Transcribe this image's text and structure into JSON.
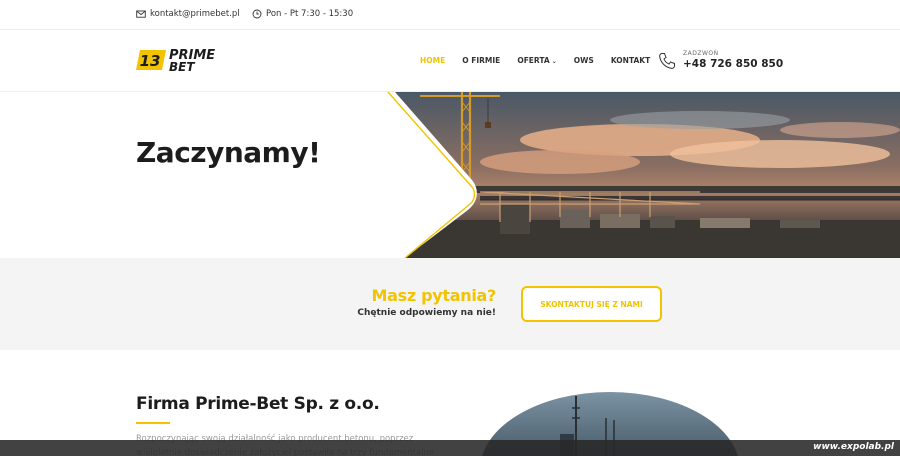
{
  "topbar": {
    "email": "kontakt@primebet.pl",
    "hours": "Pon - Pt 7:30 - 15:30"
  },
  "logo": {
    "mark": "13",
    "line1": "PRIME",
    "line2": "BET"
  },
  "nav": {
    "items": [
      {
        "label": "HOME"
      },
      {
        "label": "O FIRMIE"
      },
      {
        "label": "OFERTA"
      },
      {
        "label": "OWS"
      },
      {
        "label": "KONTAKT"
      }
    ]
  },
  "phone": {
    "label": "ZADZWOŃ",
    "number": "+48 726 850 850"
  },
  "hero": {
    "title": "Zaczynamy!"
  },
  "cta": {
    "question": "Masz pytania?",
    "subtitle": "Chętnie odpowiemy na nie!",
    "button": "SKONTAKTUJ SIĘ Z NAMI"
  },
  "about": {
    "title": "Firma Prime-Bet Sp. z o.o.",
    "text": "Rozpoczynając swoją działalność jako producent betonu, poprzez wieloletnie doświadczenie założyciel postawiła na trzy fundamentalne"
  },
  "watermark": "www.expolab.pl",
  "colors": {
    "accent": "#f2c300",
    "dark": "#1c1c1c"
  },
  "icons": {
    "email": "envelope-icon",
    "hours": "clock-icon",
    "phone": "phone-icon",
    "dropdown": "chevron-down-icon"
  }
}
